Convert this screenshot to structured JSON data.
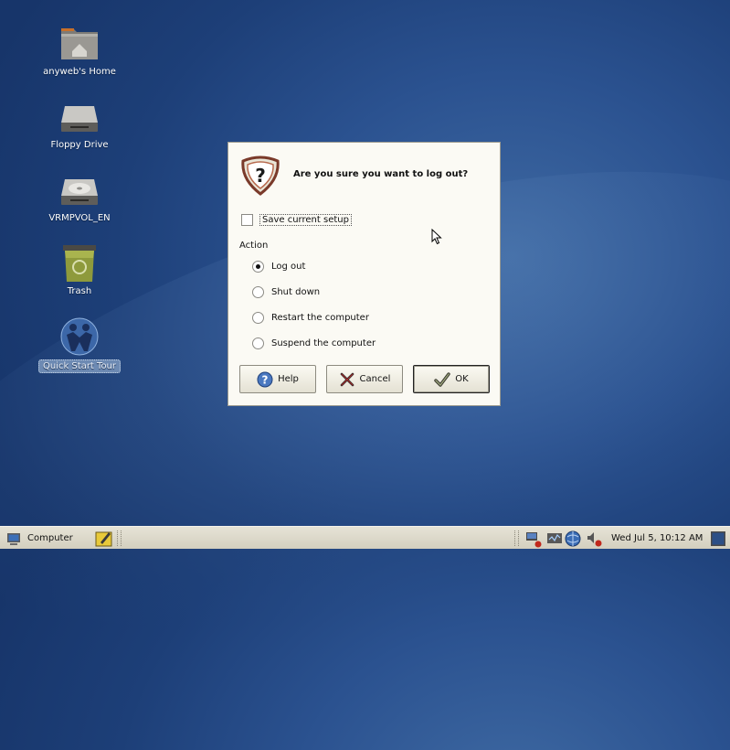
{
  "desktop": {
    "icons": [
      {
        "label": "anyweb's Home"
      },
      {
        "label": "Floppy Drive"
      },
      {
        "label": "VRMPVOL_EN"
      },
      {
        "label": "Trash"
      },
      {
        "label": "Quick Start Tour"
      }
    ]
  },
  "dialog": {
    "question": "Are you sure you want to log out?",
    "save_setup_label": "Save current setup",
    "save_setup_checked": false,
    "action_label": "Action",
    "options": [
      {
        "label": "Log out",
        "selected": true
      },
      {
        "label": "Shut down",
        "selected": false
      },
      {
        "label": "Restart the computer",
        "selected": false
      },
      {
        "label": "Suspend the computer",
        "selected": false
      }
    ],
    "buttons": {
      "help": "Help",
      "cancel": "Cancel",
      "ok": "OK"
    }
  },
  "taskbar": {
    "computer_label": "Computer",
    "clock": "Wed Jul  5, 10:12 AM"
  },
  "colors": {
    "desktop_blue": "#2b5290",
    "dialog_bg": "#fbfaf4",
    "panel_bg": "#dedbcc"
  }
}
